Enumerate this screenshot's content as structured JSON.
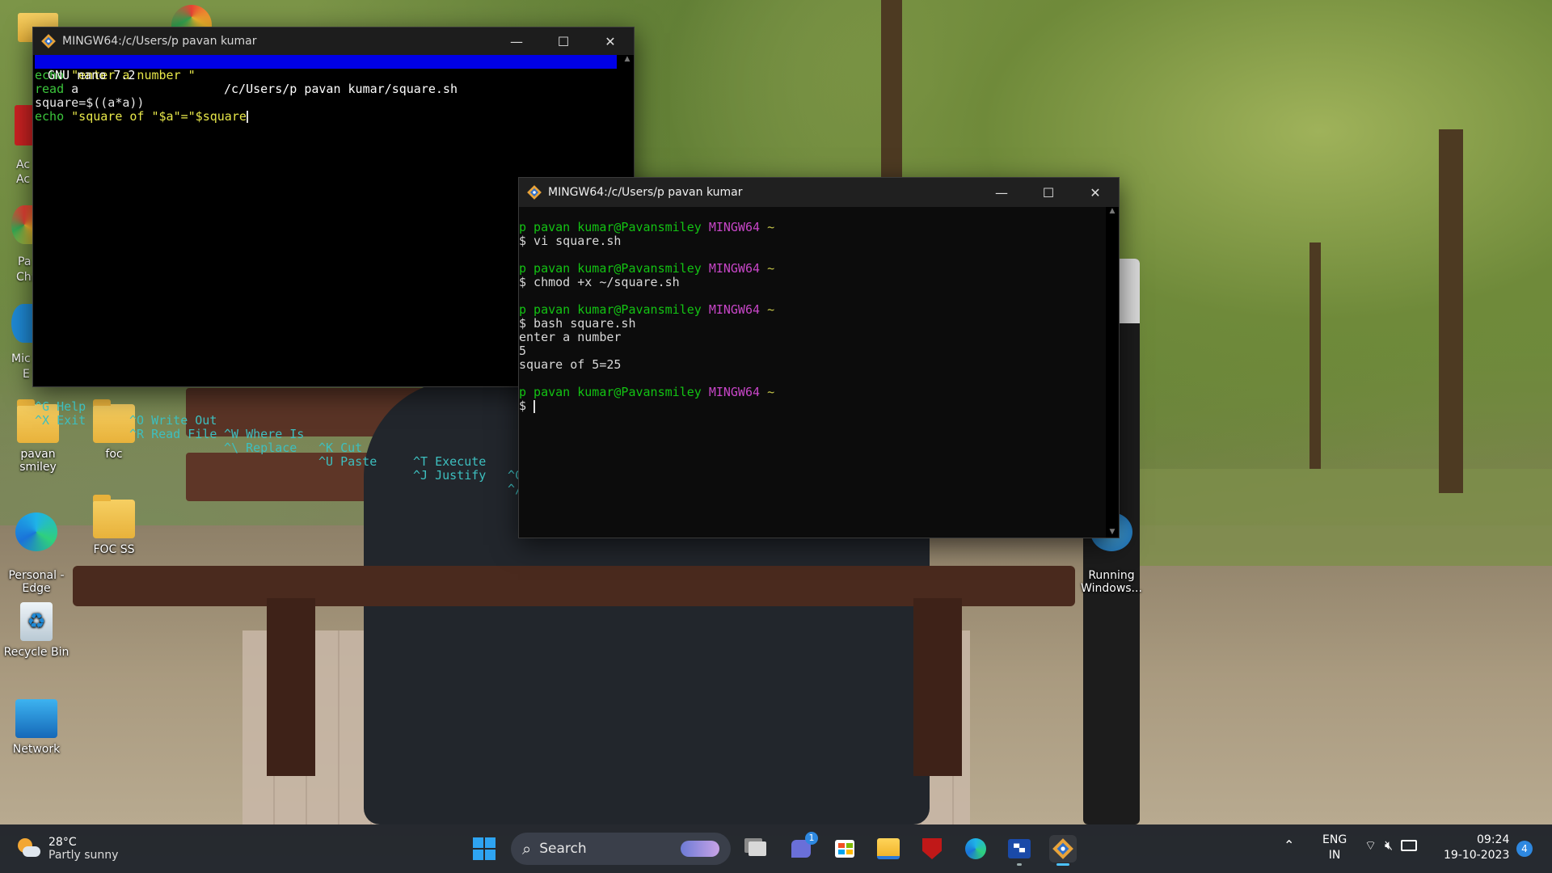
{
  "desktop": {
    "icons": [
      {
        "label": "pavan smiley"
      },
      {
        "label": "foc"
      },
      {
        "label": "Personal -\nEdge"
      },
      {
        "label": "FOC SS"
      },
      {
        "label": "Recycle Bin"
      },
      {
        "label": "Network"
      },
      {
        "label": "Running\nWindows..."
      }
    ],
    "partial_labels": [
      "Ac",
      "Ac",
      "Pa",
      "Chr",
      "Mic",
      "E"
    ]
  },
  "nano_window": {
    "title": "MINGW64:/c/Users/p pavan kumar",
    "header_left": "GNU nano 7.2",
    "header_file": "/c/Users/p pavan kumar/square.sh",
    "lines": [
      {
        "kw": "echo",
        "rest": " \"enter a number \""
      },
      {
        "kw": "read",
        "rest": " a"
      },
      {
        "kw": "square",
        "rest": "=$((a*a))"
      },
      {
        "kw": "echo",
        "rest": " \"square of \"$a\"=\"$square"
      }
    ],
    "shortcuts_row1": [
      {
        "key": "^G",
        "label": "Help"
      },
      {
        "key": "^O",
        "label": "Write Out"
      },
      {
        "key": "^W",
        "label": "Where Is"
      },
      {
        "key": "^K",
        "label": "Cut"
      },
      {
        "key": "^T",
        "label": "Execute"
      },
      {
        "key": "^C",
        "label": ""
      }
    ],
    "shortcuts_row2": [
      {
        "key": "^X",
        "label": "Exit"
      },
      {
        "key": "^R",
        "label": "Read File"
      },
      {
        "key": "^\\",
        "label": "Replace"
      },
      {
        "key": "^U",
        "label": "Paste"
      },
      {
        "key": "^J",
        "label": "Justify"
      },
      {
        "key": "^/",
        "label": ""
      }
    ]
  },
  "bash_window": {
    "title": "MINGW64:/c/Users/p pavan kumar",
    "prompt_user": "p pavan kumar@Pavansmiley",
    "prompt_env": "MINGW64",
    "prompt_dir": "~",
    "blocks": [
      {
        "cmd": "$ vi square.sh",
        "output": []
      },
      {
        "cmd": "$ chmod +x ~/square.sh",
        "output": []
      },
      {
        "cmd": "$ bash square.sh",
        "output": [
          "enter a number",
          "5",
          "square of 5=25"
        ]
      },
      {
        "cmd": "$ ",
        "output": []
      }
    ]
  },
  "taskbar": {
    "weather_temp": "28°C",
    "weather_desc": "Partly sunny",
    "search_placeholder": "Search",
    "teams_badge": "1",
    "lang_top": "ENG",
    "lang_bottom": "IN",
    "time": "09:24",
    "date": "19-10-2023",
    "notif_count": "4"
  },
  "colors": {
    "nano_header_bg": "#0000e6",
    "keyword_green": "#3cc53c",
    "string_yellow": "#e8e84a",
    "prompt_green": "#13c313",
    "prompt_magenta": "#c846c8",
    "prompt_yellow": "#c8c84a",
    "shortcut_cyan": "#3dbfbf"
  }
}
